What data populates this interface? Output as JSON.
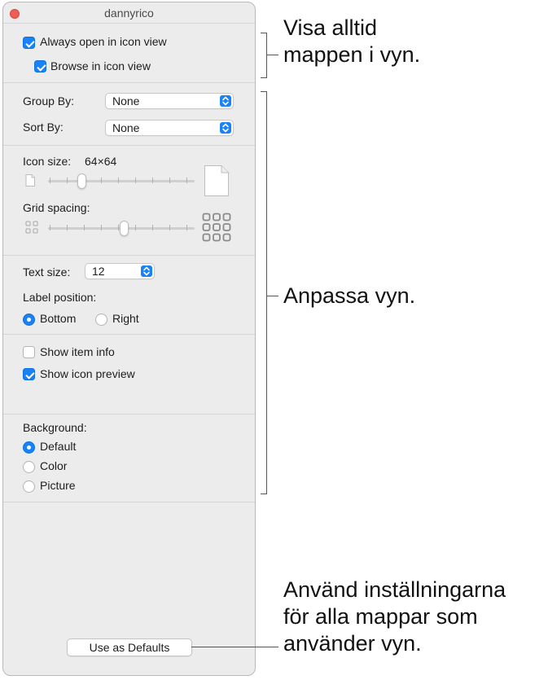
{
  "window": {
    "title": "dannyrico"
  },
  "sections": {
    "open": {
      "always_open_label": "Always open in icon view",
      "always_open_checked": true,
      "browse_label": "Browse in icon view",
      "browse_checked": true
    },
    "group_sort": {
      "group_by_label": "Group By:",
      "group_by_value": "None",
      "sort_by_label": "Sort By:",
      "sort_by_value": "None"
    },
    "icon": {
      "icon_size_label": "Icon size:",
      "icon_size_value": "64×64",
      "icon_size_level": 0.2,
      "grid_spacing_label": "Grid spacing:",
      "grid_spacing_level": 0.5
    },
    "text": {
      "text_size_label": "Text size:",
      "text_size_value": "12",
      "label_position_label": "Label position:",
      "bottom_label": "Bottom",
      "right_label": "Right",
      "selected_position": "Bottom"
    },
    "info": {
      "show_item_info_label": "Show item info",
      "show_item_info_checked": false,
      "show_icon_preview_label": "Show icon preview",
      "show_icon_preview_checked": true
    },
    "background": {
      "label": "Background:",
      "default_label": "Default",
      "color_label": "Color",
      "picture_label": "Picture",
      "selected": "Default"
    }
  },
  "button": {
    "use_as_defaults_label": "Use as Defaults"
  },
  "callouts": {
    "top": [
      "Visa alltid",
      "mappen i vyn."
    ],
    "middle": "Anpassa vyn.",
    "bottom": [
      "Använd inställningarna",
      "för alla mappar som",
      "använder vyn."
    ]
  },
  "colors": {
    "accent": "#1a82f7",
    "close": "#f05d57"
  }
}
